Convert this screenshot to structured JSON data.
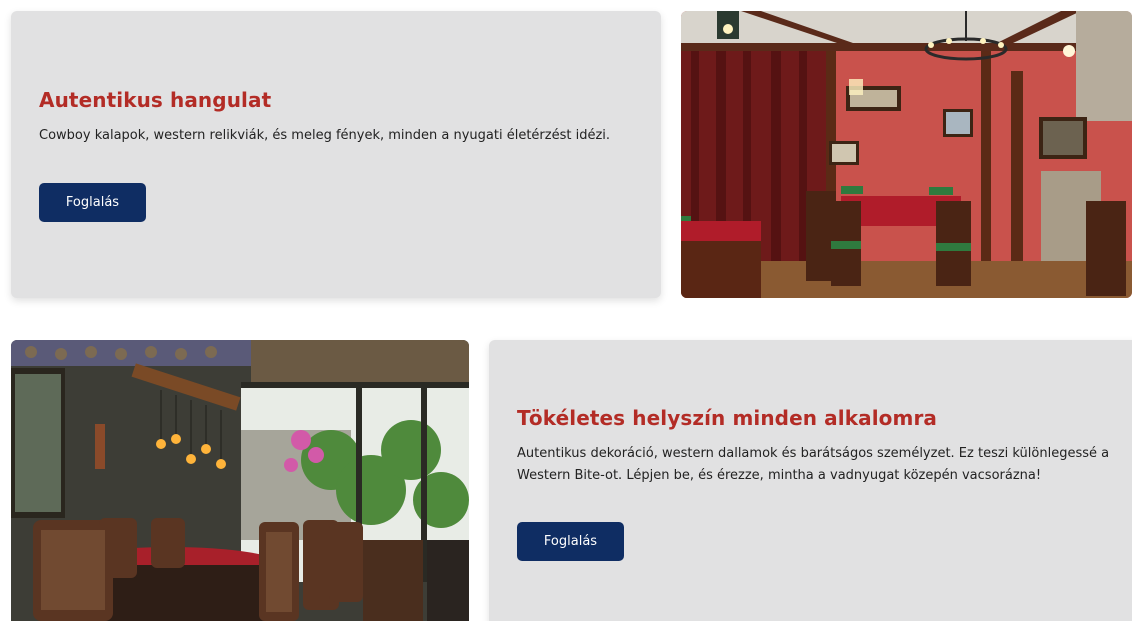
{
  "sections": [
    {
      "title": "Autentikus hangulat",
      "text": "Cowboy kalapok, western relikviák, és meleg fények, minden a nyugati életérzést idézi.",
      "button_label": "Foglalás",
      "image": "western-restaurant-red-dining-room-photo"
    },
    {
      "title": "Tökéletes helyszín minden alkalomra",
      "text": "Autentikus dekoráció, western dallamok és barátságos személyzet. Ez teszi különlegessé a Western Bite-ot. Lépjen be, és érezze, mintha a vadnyugat közepén vacsorázna!",
      "button_label": "Foglalás",
      "image": "restaurant-dining-table-edison-bulbs-photo"
    }
  ],
  "colors": {
    "card_bg": "#e1e1e2",
    "title": "#b32c26",
    "button": "#0f2d63"
  }
}
